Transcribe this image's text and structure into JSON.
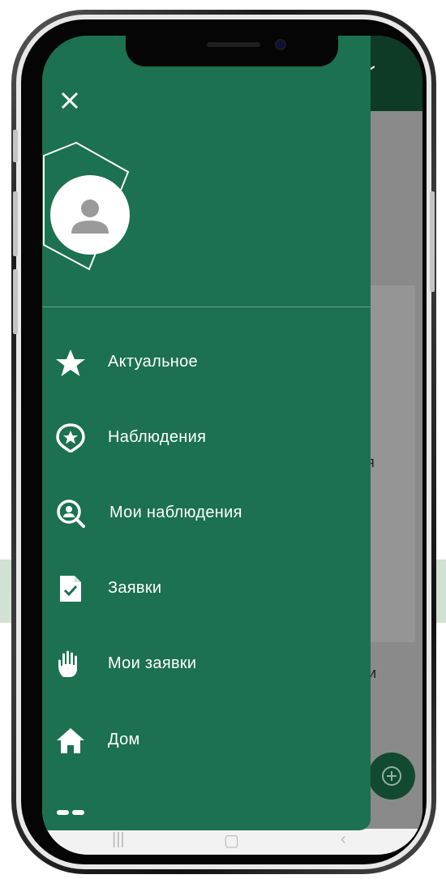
{
  "drawer": {
    "menu": [
      {
        "label": "Актуальное",
        "icon": "star-icon"
      },
      {
        "label": "Наблюдения",
        "icon": "star-pin-icon"
      },
      {
        "label": "Мои наблюдения",
        "icon": "person-search-icon"
      },
      {
        "label": "Заявки",
        "icon": "document-check-icon"
      },
      {
        "label": "Мои заявки",
        "icon": "hand-icon"
      },
      {
        "label": "Дом",
        "icon": "home-icon"
      }
    ]
  },
  "background_app": {
    "fragment_1": "я",
    "fragment_2": "и"
  },
  "colors": {
    "drawer": "#1b7150",
    "header": "#0e3a26",
    "fab": "#114a30"
  }
}
